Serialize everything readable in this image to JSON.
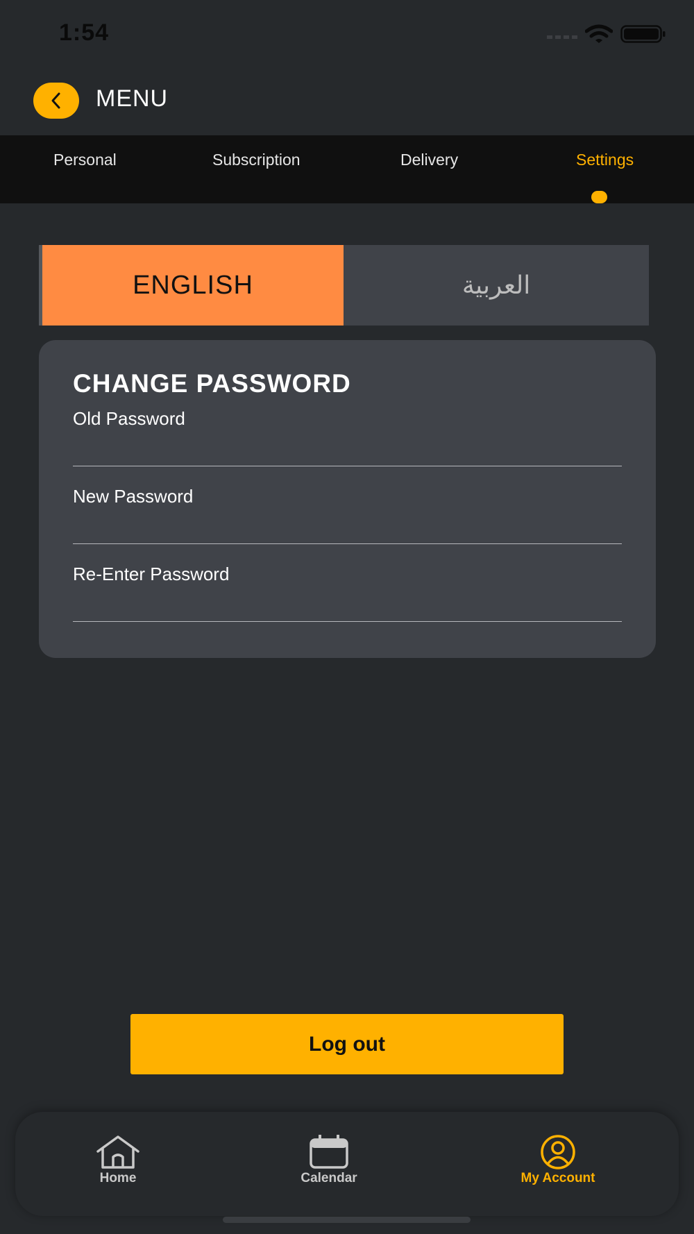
{
  "status_bar": {
    "time": "1:54"
  },
  "header": {
    "title": "MENU",
    "back_icon": "chevron-left-icon"
  },
  "tabs": [
    {
      "label": "Personal",
      "active": false
    },
    {
      "label": "Subscription",
      "active": false
    },
    {
      "label": "Delivery",
      "active": false
    },
    {
      "label": "Settings",
      "active": true
    }
  ],
  "language": {
    "english_label": "ENGLISH",
    "arabic_label": "العربية",
    "selected": "english"
  },
  "change_password": {
    "title": "CHANGE PASSWORD",
    "fields": [
      {
        "label": "Old Password",
        "value": ""
      },
      {
        "label": "New Password",
        "value": ""
      },
      {
        "label": "Re-Enter Password",
        "value": ""
      }
    ]
  },
  "logout": {
    "label": "Log out"
  },
  "bottom_nav": [
    {
      "label": "Home",
      "icon": "home-icon",
      "active": false
    },
    {
      "label": "Calendar",
      "icon": "calendar-icon",
      "active": false
    },
    {
      "label": "My Account",
      "icon": "account-icon",
      "active": true
    }
  ],
  "colors": {
    "accent": "#ffb100",
    "language_selected": "#ff8b42",
    "background": "#26292c",
    "card": "#404349",
    "tab_bar": "#101010"
  }
}
